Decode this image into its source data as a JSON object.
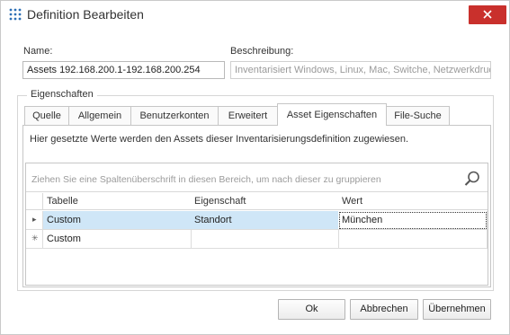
{
  "window": {
    "title": "Definition Bearbeiten"
  },
  "form": {
    "name_label": "Name:",
    "name_value": "Assets 192.168.200.1-192.168.200.254",
    "description_label": "Beschreibung:",
    "description_value": "Inventarisiert Windows, Linux, Mac, Switche, Netzwerkdruc"
  },
  "properties_group": {
    "legend": "Eigenschaften"
  },
  "tabs": [
    {
      "label": "Quelle"
    },
    {
      "label": "Allgemein"
    },
    {
      "label": "Benutzerkonten"
    },
    {
      "label": "Erweitert"
    },
    {
      "label": "Asset Eigenschaften",
      "active": true
    },
    {
      "label": "File-Suche"
    }
  ],
  "panel": {
    "info": "Hier gesetzte Werte werden den Assets dieser Inventarisierungsdefinition zugewiesen."
  },
  "grid": {
    "group_hint": "Ziehen Sie eine Spaltenüberschrift in diesen Bereich, um nach dieser zu gruppieren",
    "columns": [
      "Tabelle",
      "Eigenschaft",
      "Wert"
    ],
    "rows": [
      {
        "indicator": "▸",
        "tabelle": "Custom",
        "eigenschaft": "Standort",
        "wert": "München"
      },
      {
        "indicator": "✳",
        "tabelle": "Custom",
        "eigenschaft": "",
        "wert": ""
      }
    ]
  },
  "buttons": {
    "ok": "Ok",
    "cancel": "Abbrechen",
    "apply": "Übernehmen"
  },
  "colors": {
    "close": "#c9302c",
    "selection": "#cfe6f7",
    "icon": "#2d6fb5"
  },
  "icons": {
    "app": "grid-dots-icon",
    "close": "close-icon",
    "search": "search-icon",
    "current_row": "row-pointer-icon",
    "new_row": "new-row-icon"
  }
}
